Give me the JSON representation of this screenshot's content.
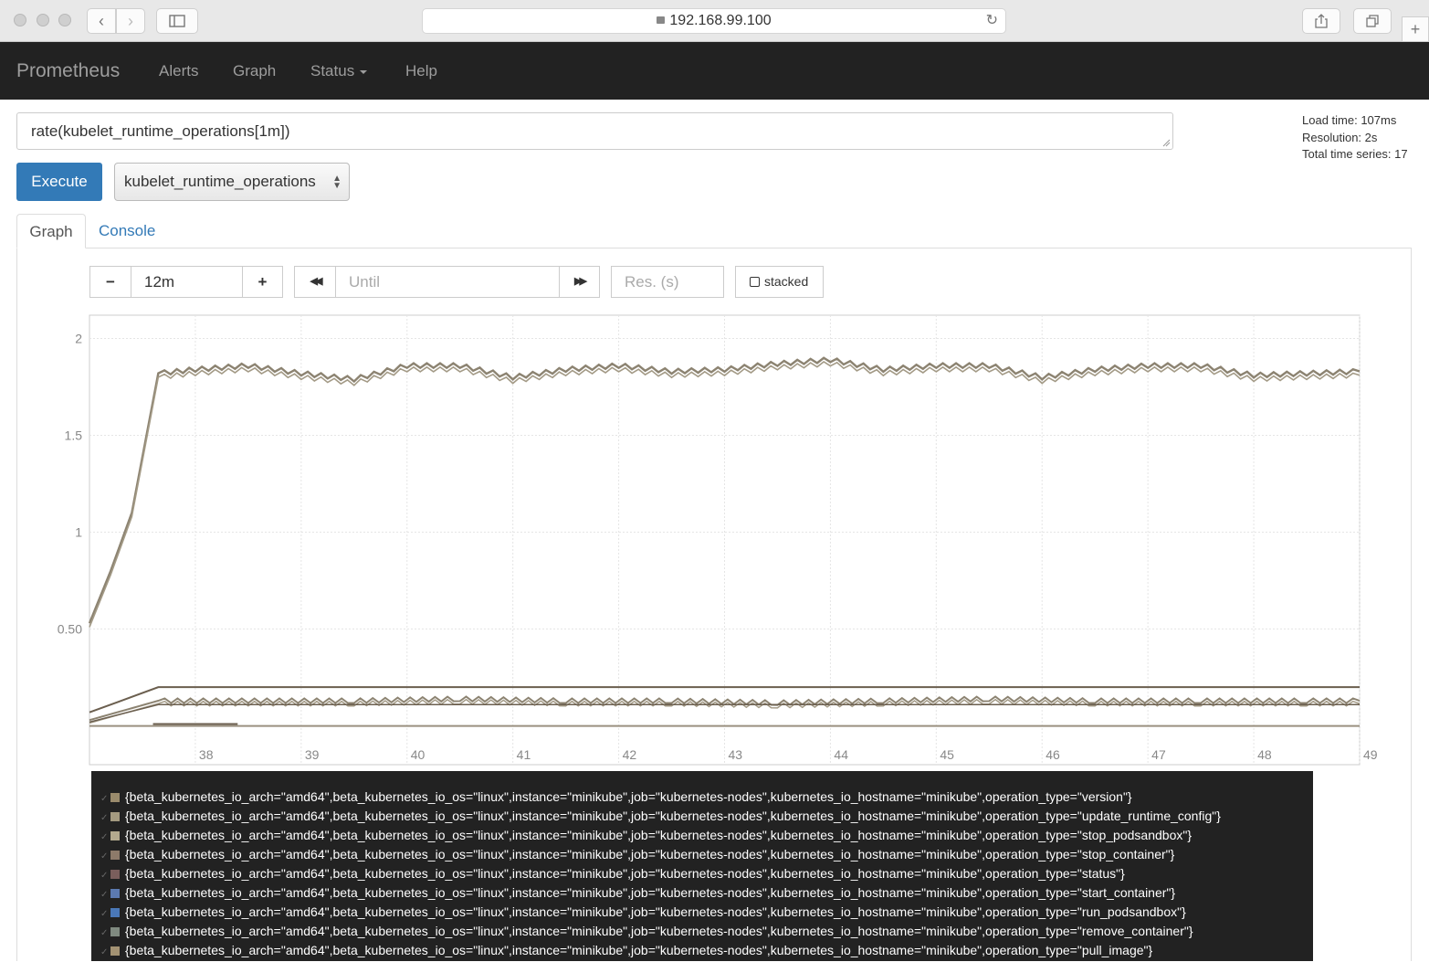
{
  "browser": {
    "url": "192.168.99.100"
  },
  "nav": {
    "brand": "Prometheus",
    "items": [
      "Alerts",
      "Graph",
      "Status",
      "Help"
    ]
  },
  "query": {
    "expression": "rate(kubelet_runtime_operations[1m])",
    "execute_label": "Execute",
    "metric_select": "kubelet_runtime_operations",
    "stats": {
      "load_time": "Load time: 107ms",
      "resolution": "Resolution: 2s",
      "total_series": "Total time series: 17"
    }
  },
  "tabs": [
    "Graph",
    "Console"
  ],
  "controls": {
    "minus": "−",
    "range": "12m",
    "plus": "+",
    "back": "◀◀",
    "until_placeholder": "Until",
    "forward": "▶▶",
    "res_placeholder": "Res. (s)",
    "stacked": "stacked"
  },
  "colors": {
    "line": "#8c8371",
    "line_dark": "#6b5f4f",
    "grid": "#e5e5e5"
  },
  "chart_data": {
    "type": "line",
    "x_ticks": [
      "38",
      "39",
      "40",
      "41",
      "42",
      "43",
      "44",
      "45",
      "46",
      "47",
      "48",
      "49"
    ],
    "y_ticks": [
      "2",
      "1.5",
      "1",
      "0.50"
    ],
    "xlim": [
      37.0,
      49.0
    ],
    "ylim": [
      -0.2,
      2.12
    ],
    "grid": true,
    "series_approx": [
      {
        "x": [
          37.0,
          37.2,
          37.4,
          37.65,
          38.0,
          38.5,
          39.0,
          39.5,
          40.0,
          40.5,
          41.0,
          41.5,
          42.0,
          42.5,
          43.0,
          43.5,
          44.0,
          44.5,
          45.0,
          45.5,
          46.0,
          46.5,
          47.0,
          47.5,
          48.0,
          48.5,
          49.0
        ],
        "y": [
          0.53,
          0.8,
          1.1,
          1.82,
          1.84,
          1.86,
          1.82,
          1.79,
          1.86,
          1.86,
          1.8,
          1.84,
          1.86,
          1.83,
          1.84,
          1.87,
          1.89,
          1.84,
          1.86,
          1.86,
          1.8,
          1.84,
          1.86,
          1.86,
          1.81,
          1.82,
          1.83
        ]
      },
      {
        "x": [
          37.0,
          37.65,
          49.0
        ],
        "y": [
          0.07,
          0.2,
          0.2
        ]
      },
      {
        "x": [
          37.0,
          37.65,
          38.5,
          39.5,
          40.5,
          41.5,
          42.5,
          43.5,
          44.5,
          45.5,
          46.5,
          47.5,
          48.5,
          49.0
        ],
        "y": [
          0.03,
          0.13,
          0.13,
          0.13,
          0.14,
          0.13,
          0.13,
          0.12,
          0.13,
          0.14,
          0.13,
          0.13,
          0.13,
          0.13
        ]
      },
      {
        "x": [
          37.0,
          37.65,
          49.0
        ],
        "y": [
          0.02,
          0.11,
          0.11
        ]
      },
      {
        "x": [
          37.0,
          49.0
        ],
        "y": [
          0.0,
          0.0
        ]
      },
      {
        "x": [
          37.6,
          38.4
        ],
        "y": [
          0.01,
          0.01
        ]
      }
    ]
  },
  "legend": [
    {
      "label": "{beta_kubernetes_io_arch=\"amd64\",beta_kubernetes_io_os=\"linux\",instance=\"minikube\",job=\"kubernetes-nodes\",kubernetes_io_hostname=\"minikube\",operation_type=\"version\"}",
      "color": "#9a8b6c"
    },
    {
      "label": "{beta_kubernetes_io_arch=\"amd64\",beta_kubernetes_io_os=\"linux\",instance=\"minikube\",job=\"kubernetes-nodes\",kubernetes_io_hostname=\"minikube\",operation_type=\"update_runtime_config\"}",
      "color": "#a49a80"
    },
    {
      "label": "{beta_kubernetes_io_arch=\"amd64\",beta_kubernetes_io_os=\"linux\",instance=\"minikube\",job=\"kubernetes-nodes\",kubernetes_io_hostname=\"minikube\",operation_type=\"stop_podsandbox\"}",
      "color": "#b3a98e"
    },
    {
      "label": "{beta_kubernetes_io_arch=\"amd64\",beta_kubernetes_io_os=\"linux\",instance=\"minikube\",job=\"kubernetes-nodes\",kubernetes_io_hostname=\"minikube\",operation_type=\"stop_container\"}",
      "color": "#8d7a6a"
    },
    {
      "label": "{beta_kubernetes_io_arch=\"amd64\",beta_kubernetes_io_os=\"linux\",instance=\"minikube\",job=\"kubernetes-nodes\",kubernetes_io_hostname=\"minikube\",operation_type=\"status\"}",
      "color": "#7a5e5c"
    },
    {
      "label": "{beta_kubernetes_io_arch=\"amd64\",beta_kubernetes_io_os=\"linux\",instance=\"minikube\",job=\"kubernetes-nodes\",kubernetes_io_hostname=\"minikube\",operation_type=\"start_container\"}",
      "color": "#5c7ab0"
    },
    {
      "label": "{beta_kubernetes_io_arch=\"amd64\",beta_kubernetes_io_os=\"linux\",instance=\"minikube\",job=\"kubernetes-nodes\",kubernetes_io_hostname=\"minikube\",operation_type=\"run_podsandbox\"}",
      "color": "#4a78b8"
    },
    {
      "label": "{beta_kubernetes_io_arch=\"amd64\",beta_kubernetes_io_os=\"linux\",instance=\"minikube\",job=\"kubernetes-nodes\",kubernetes_io_hostname=\"minikube\",operation_type=\"remove_container\"}",
      "color": "#7f8a80"
    },
    {
      "label": "{beta_kubernetes_io_arch=\"amd64\",beta_kubernetes_io_os=\"linux\",instance=\"minikube\",job=\"kubernetes-nodes\",kubernetes_io_hostname=\"minikube\",operation_type=\"pull_image\"}",
      "color": "#a39273"
    }
  ]
}
